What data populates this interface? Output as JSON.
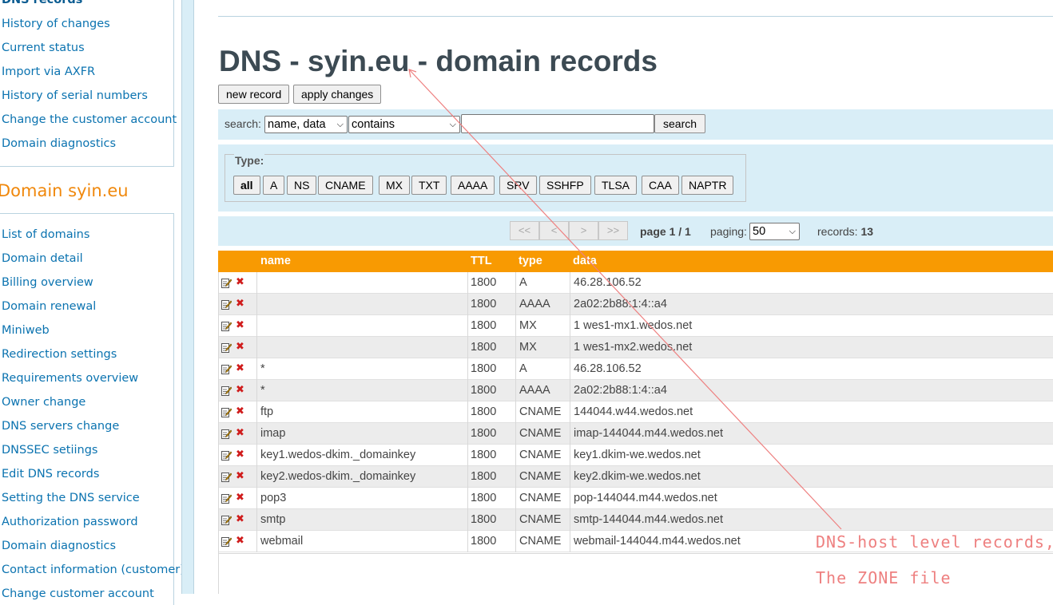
{
  "sidebar": {
    "top_items": [
      {
        "label": "DNS records",
        "current": true
      },
      {
        "label": "History of changes"
      },
      {
        "label": "Current status"
      },
      {
        "label": "Import via AXFR"
      },
      {
        "label": "History of serial numbers"
      },
      {
        "label": "Change the customer account"
      },
      {
        "label": "Domain diagnostics"
      }
    ],
    "section_title": "Domain syin.eu",
    "domain_items": [
      {
        "label": "List of domains"
      },
      {
        "label": "Domain detail"
      },
      {
        "label": "Billing overview"
      },
      {
        "label": "Domain renewal"
      },
      {
        "label": "Miniweb"
      },
      {
        "label": "Redirection settings"
      },
      {
        "label": "Requirements overview"
      },
      {
        "label": "Owner change"
      },
      {
        "label": "DNS servers change"
      },
      {
        "label": "DNSSEC setiings"
      },
      {
        "label": "Edit DNS records"
      },
      {
        "label": "Setting the DNS service"
      },
      {
        "label": "Authorization password"
      },
      {
        "label": "Domain diagnostics"
      },
      {
        "label": "Contact information (customer)"
      },
      {
        "label": "Change customer account"
      }
    ]
  },
  "main": {
    "title": "DNS - syin.eu - domain records",
    "new_record_label": "new record",
    "apply_changes_label": "apply changes",
    "search": {
      "label": "search:",
      "field_select": "name, data",
      "mode_select": "contains",
      "query": "",
      "button_label": "search"
    },
    "type_filter": {
      "legend": "Type:",
      "types": [
        "all",
        "A",
        "NS",
        "CNAME",
        "MX",
        "TXT",
        "AAAA",
        "SRV",
        "SSHFP",
        "TLSA",
        "CAA",
        "NAPTR"
      ],
      "active": "all"
    },
    "pager": {
      "first": "<<",
      "prev": "<",
      "next": ">",
      "last": ">>",
      "page_text": "page 1 / 1",
      "paging_label": "paging:",
      "paging_value": "50",
      "records_label": "records:",
      "records_count": "13"
    },
    "table": {
      "columns": [
        "name",
        "TTL",
        "type",
        "data"
      ],
      "rows": [
        {
          "name": "",
          "ttl": "1800",
          "type": "A",
          "data": "46.28.106.52"
        },
        {
          "name": "",
          "ttl": "1800",
          "type": "AAAA",
          "data": "2a02:2b88:1:4::a4"
        },
        {
          "name": "",
          "ttl": "1800",
          "type": "MX",
          "data": "1 wes1-mx1.wedos.net"
        },
        {
          "name": "",
          "ttl": "1800",
          "type": "MX",
          "data": "1 wes1-mx2.wedos.net"
        },
        {
          "name": "*",
          "ttl": "1800",
          "type": "A",
          "data": "46.28.106.52"
        },
        {
          "name": "*",
          "ttl": "1800",
          "type": "AAAA",
          "data": "2a02:2b88:1:4::a4"
        },
        {
          "name": "ftp",
          "ttl": "1800",
          "type": "CNAME",
          "data": "144044.w44.wedos.net"
        },
        {
          "name": "imap",
          "ttl": "1800",
          "type": "CNAME",
          "data": "imap-144044.m44.wedos.net"
        },
        {
          "name": "key1.wedos-dkim._domainkey",
          "ttl": "1800",
          "type": "CNAME",
          "data": "key1.dkim-we.wedos.net"
        },
        {
          "name": "key2.wedos-dkim._domainkey",
          "ttl": "1800",
          "type": "CNAME",
          "data": "key2.dkim-we.wedos.net"
        },
        {
          "name": "pop3",
          "ttl": "1800",
          "type": "CNAME",
          "data": "pop-144044.m44.wedos.net"
        },
        {
          "name": "smtp",
          "ttl": "1800",
          "type": "CNAME",
          "data": "smtp-144044.m44.wedos.net"
        },
        {
          "name": "webmail",
          "ttl": "1800",
          "type": "CNAME",
          "data": "webmail-144044.m44.wedos.net"
        }
      ]
    }
  },
  "annotation": {
    "line1": "DNS-host level records,",
    "line2": "The ZONE file",
    "color": "#ee8080"
  },
  "colors": {
    "accent_orange": "#f89a02",
    "link_blue": "#0b73b0",
    "band_blue": "#d9eef7",
    "delete_red": "#d01c1c"
  },
  "icons": {
    "edit": "edit-icon",
    "delete": "delete-icon"
  }
}
